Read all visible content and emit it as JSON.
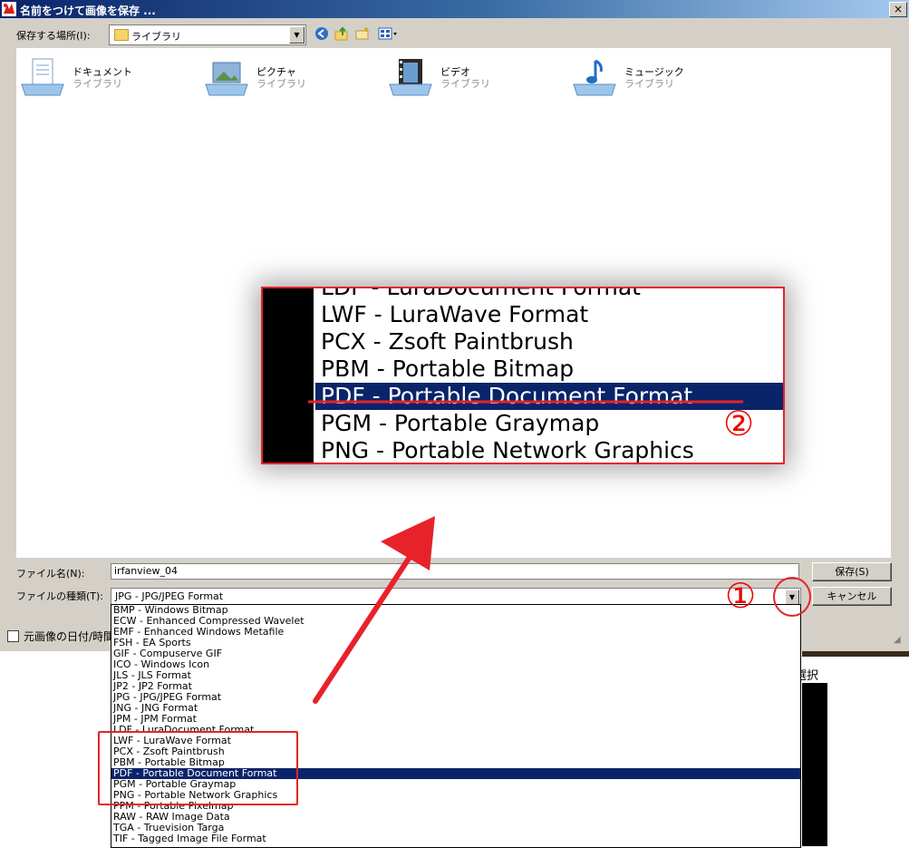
{
  "title": "名前をつけて画像を保存 ...",
  "close_label": "×",
  "location": {
    "label": "保存する場所(I):",
    "value": "ライブラリ"
  },
  "libraries": [
    {
      "name": "ドキュメント",
      "sub": "ライブラリ",
      "icon": "documents-library-icon"
    },
    {
      "name": "ピクチャ",
      "sub": "ライブラリ",
      "icon": "pictures-library-icon"
    },
    {
      "name": "ビデオ",
      "sub": "ライブラリ",
      "icon": "videos-library-icon"
    },
    {
      "name": "ミュージック",
      "sub": "ライブラリ",
      "icon": "music-library-icon"
    }
  ],
  "filename": {
    "label": "ファイル名(N):",
    "value": "irfanview_04"
  },
  "filetype": {
    "label": "ファイルの種類(T):",
    "value": "JPG - JPG/JPEG Format"
  },
  "buttons": {
    "save": "保存(S)",
    "cancel": "キャンセル"
  },
  "checkbox_label": "元画像の日付/時間",
  "bg_text": "選択",
  "format_options": [
    "BMP - Windows Bitmap",
    "ECW - Enhanced Compressed Wavelet",
    "EMF - Enhanced Windows Metafile",
    "FSH - EA Sports",
    "GIF - Compuserve GIF",
    "ICO - Windows Icon",
    "JLS - JLS Format",
    "JP2 - JP2 Format",
    "JPG - JPG/JPEG Format",
    "JNG - JNG Format",
    "JPM - JPM Format",
    "LDF - LuraDocument Format",
    "LWF - LuraWave Format",
    "PCX - Zsoft Paintbrush",
    "PBM - Portable Bitmap",
    "PDF - Portable Document Format",
    "PGM - Portable Graymap",
    "PNG - Portable Network Graphics",
    "PPM - Portable Pixelmap",
    "RAW - RAW Image Data",
    "TGA - Truevision Targa",
    "TIF - Tagged Image File Format"
  ],
  "selected_format": "PDF - Portable Document Format",
  "zoom_options": [
    "LDF - LuraDocument Format",
    "LWF - LuraWave Format",
    "PCX - Zsoft Paintbrush",
    "PBM - Portable Bitmap",
    "PDF - Portable Document Format",
    "PGM - Portable Graymap",
    "PNG - Portable Network Graphics"
  ],
  "annotations": {
    "step1": "①",
    "step2": "②",
    "color": "#e8222a"
  }
}
